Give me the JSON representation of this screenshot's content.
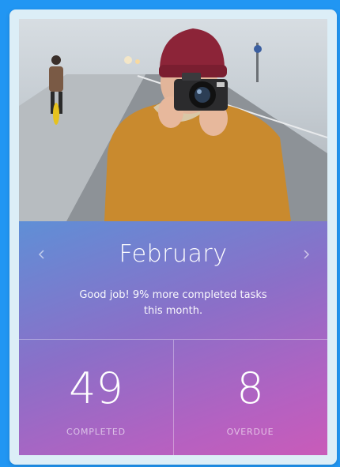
{
  "calendar": {
    "month": "February",
    "message": "Good job! 9% more completed tasks this month.",
    "prev_icon": "chevron-left-icon",
    "next_icon": "chevron-right-icon"
  },
  "stats": [
    {
      "value": "49",
      "label": "COMPLETED"
    },
    {
      "value": "8",
      "label": "OVERDUE"
    }
  ],
  "colors": {
    "page_background": "#2196f3",
    "gradient_start": "#5f8fd6",
    "gradient_end": "#c95bb9",
    "jacket": "#c98a2e",
    "hat": "#8c2438"
  }
}
